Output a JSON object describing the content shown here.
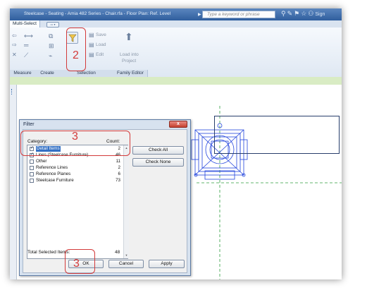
{
  "window": {
    "title": "Steelcase - Seating - Amia 482 Series - Chair.rfa - Floor Plan: Ref. Level",
    "search_placeholder": "Type a keyword or phrase",
    "sign_in": "Sign"
  },
  "tabs": {
    "active": "Multi-Select"
  },
  "ribbon": {
    "panels": [
      "Measure",
      "Create",
      "Selection",
      "Family Editor"
    ],
    "selection_buttons": [
      "Save",
      "Load",
      "Edit"
    ],
    "family_editor_button": "Load into Project",
    "load_line1": "Load into",
    "load_line2": "Project"
  },
  "filter_dialog": {
    "title": "Filter",
    "close_label": "x",
    "category_header": "Category:",
    "count_header": "Count:",
    "categories": [
      {
        "name": "Detail Items",
        "count": "2",
        "checked": true,
        "selected": true
      },
      {
        "name": "Lines (Steelcase Furniture)",
        "count": "46",
        "checked": true,
        "selected": false
      },
      {
        "name": "Other",
        "count": "11",
        "checked": false,
        "selected": false
      },
      {
        "name": "Reference Lines",
        "count": "2",
        "checked": false,
        "selected": false
      },
      {
        "name": "Reference Planes",
        "count": "6",
        "checked": false,
        "selected": false
      },
      {
        "name": "Steelcase Furniture",
        "count": "73",
        "checked": false,
        "selected": false
      }
    ],
    "check_all": "Check All",
    "check_none": "Check None",
    "total_label": "Total Selected Items:",
    "total_value": "48",
    "ok": "OK",
    "cancel": "Cancel",
    "apply": "Apply"
  },
  "annotations": {
    "step_filter": "2",
    "step_dialog": "3",
    "step_ok": "3"
  },
  "colors": {
    "titlebar": "#2f5e9e",
    "callout": "#d33a3a",
    "selection_blue": "#2244dd",
    "guide_green": "#2e9e3e"
  }
}
